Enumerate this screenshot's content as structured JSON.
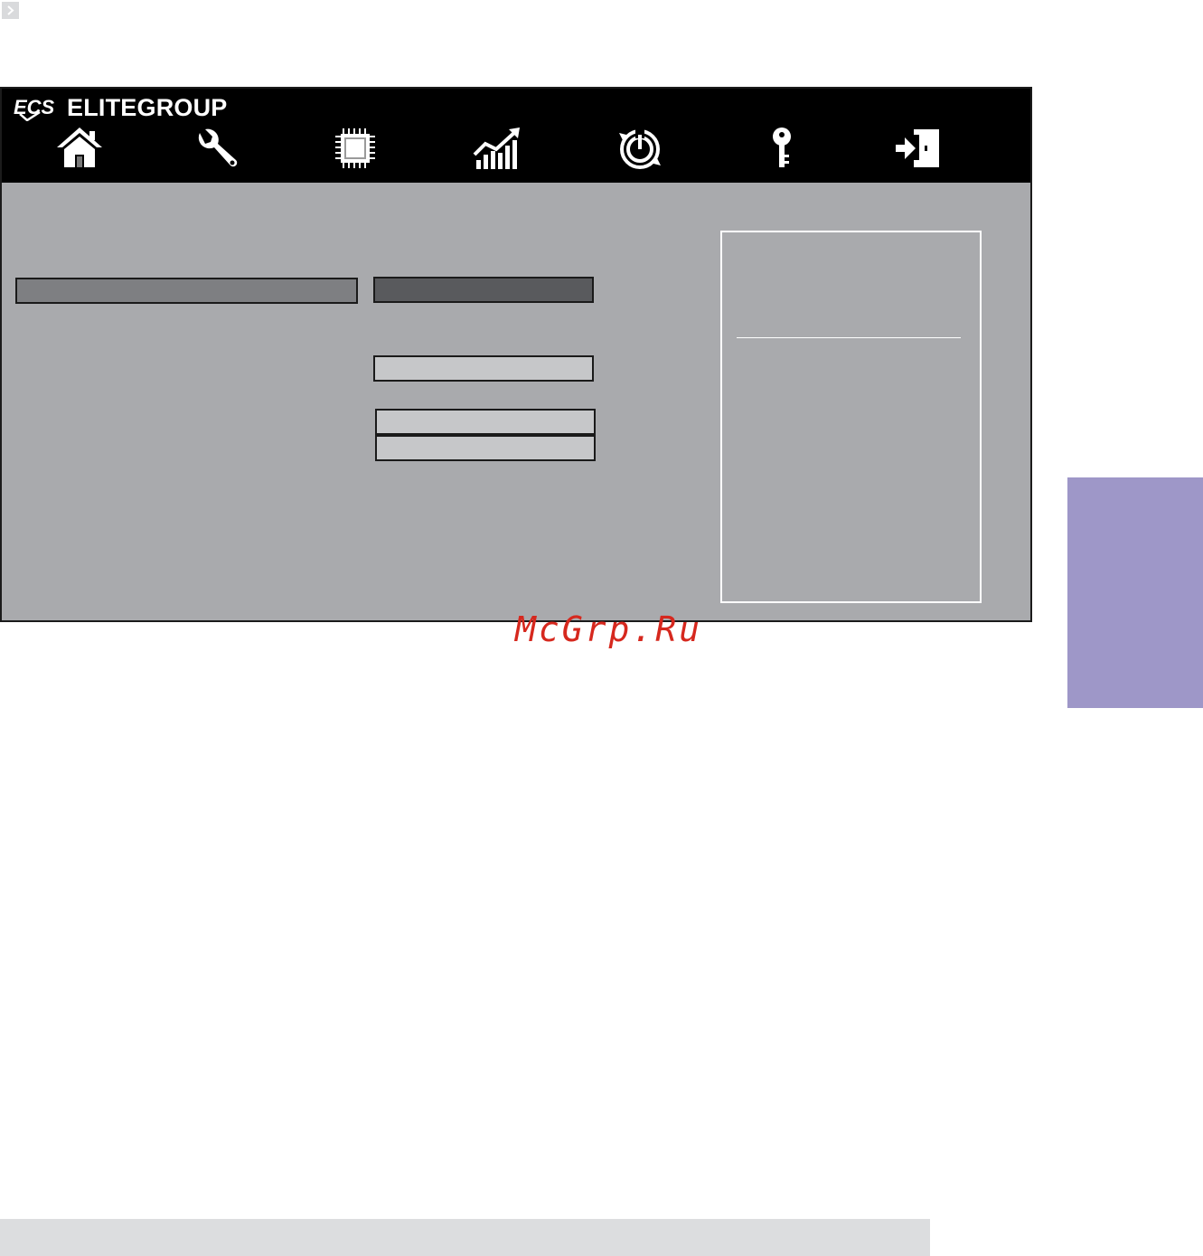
{
  "brand": {
    "name": "ELITEGROUP",
    "logo": "ECS",
    "logo_icon": "ecs-logo-icon"
  },
  "nav": {
    "icons": [
      {
        "name": "home-icon",
        "semantic": "Main"
      },
      {
        "name": "wrench-icon",
        "semantic": "Advanced"
      },
      {
        "name": "chip-icon",
        "semantic": "Chipset"
      },
      {
        "name": "performance-chart-icon",
        "semantic": "M.I.B."
      },
      {
        "name": "power-icon",
        "semantic": "Boot"
      },
      {
        "name": "key-icon",
        "semantic": "Security"
      },
      {
        "name": "exit-icon",
        "semantic": "Save & Exit"
      }
    ]
  },
  "colors": {
    "header": "#000000",
    "panel": "#a9aaad",
    "selected_item": "#7e7f82",
    "selected_value": "#595a5d",
    "value_field": "#c6c7c9",
    "help_border": "#ffffff",
    "side_tab": "#9e97c8",
    "footer": "#dcdddf",
    "watermark": "#d6281e"
  },
  "watermark": {
    "text": "McGrp.Ru"
  }
}
